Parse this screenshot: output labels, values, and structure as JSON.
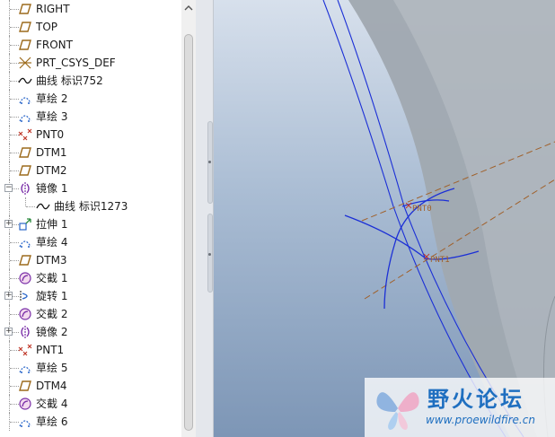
{
  "model_tree": {
    "items": [
      {
        "icon": "datum-plane-icon",
        "label": "RIGHT",
        "expandable": false,
        "child": false
      },
      {
        "icon": "datum-plane-icon",
        "label": "TOP",
        "expandable": false,
        "child": false
      },
      {
        "icon": "datum-plane-icon",
        "label": "FRONT",
        "expandable": false,
        "child": false
      },
      {
        "icon": "csys-icon",
        "label": "PRT_CSYS_DEF",
        "expandable": false,
        "child": false
      },
      {
        "icon": "curve-icon",
        "label": "曲线 标识752",
        "expandable": false,
        "child": false
      },
      {
        "icon": "sketch-icon",
        "label": "草绘 2",
        "expandable": false,
        "child": false
      },
      {
        "icon": "sketch-icon",
        "label": "草绘 3",
        "expandable": false,
        "child": false
      },
      {
        "icon": "datum-point-icon",
        "label": "PNT0",
        "expandable": false,
        "child": false
      },
      {
        "icon": "datum-plane-icon",
        "label": "DTM1",
        "expandable": false,
        "child": false
      },
      {
        "icon": "datum-plane-icon",
        "label": "DTM2",
        "expandable": false,
        "child": false
      },
      {
        "icon": "mirror-icon",
        "label": "镜像 1",
        "expandable": true,
        "expanded": true,
        "child": false
      },
      {
        "icon": "curve-icon",
        "label": "曲线 标识1273",
        "expandable": false,
        "child": true
      },
      {
        "icon": "extrude-icon",
        "label": "拉伸 1",
        "expandable": true,
        "expanded": false,
        "child": false
      },
      {
        "icon": "sketch-icon",
        "label": "草绘 4",
        "expandable": false,
        "child": false
      },
      {
        "icon": "datum-plane-icon",
        "label": "DTM3",
        "expandable": false,
        "child": false
      },
      {
        "icon": "intersect-icon",
        "label": "交截 1",
        "expandable": false,
        "child": false
      },
      {
        "icon": "revolve-icon",
        "label": "旋转 1",
        "expandable": true,
        "expanded": false,
        "child": false
      },
      {
        "icon": "intersect-icon",
        "label": "交截 2",
        "expandable": false,
        "child": false
      },
      {
        "icon": "mirror-icon",
        "label": "镜像 2",
        "expandable": true,
        "expanded": false,
        "child": false
      },
      {
        "icon": "datum-point-icon",
        "label": "PNT1",
        "expandable": false,
        "child": false
      },
      {
        "icon": "sketch-icon",
        "label": "草绘 5",
        "expandable": false,
        "child": false
      },
      {
        "icon": "datum-plane-icon",
        "label": "DTM4",
        "expandable": false,
        "child": false
      },
      {
        "icon": "intersect-icon",
        "label": "交截 4",
        "expandable": false,
        "child": false
      },
      {
        "icon": "sketch-icon",
        "label": "草绘 6",
        "expandable": false,
        "child": false
      }
    ]
  },
  "viewport": {
    "point_labels": [
      "PNT0",
      "PNT1"
    ]
  },
  "watermark": {
    "title": "野火论坛",
    "url": "www.proewildfire.cn"
  },
  "colors": {
    "datum_plane": "#9c6a1c",
    "sketch": "#2a66c9",
    "curve": "#111111",
    "point": "#c0392b",
    "feature": "#7a2fa8",
    "viewport_curve": "#1b2fd6",
    "datum_axis_dashed": "#a0602a",
    "watermark_text": "#1f6fc0"
  }
}
